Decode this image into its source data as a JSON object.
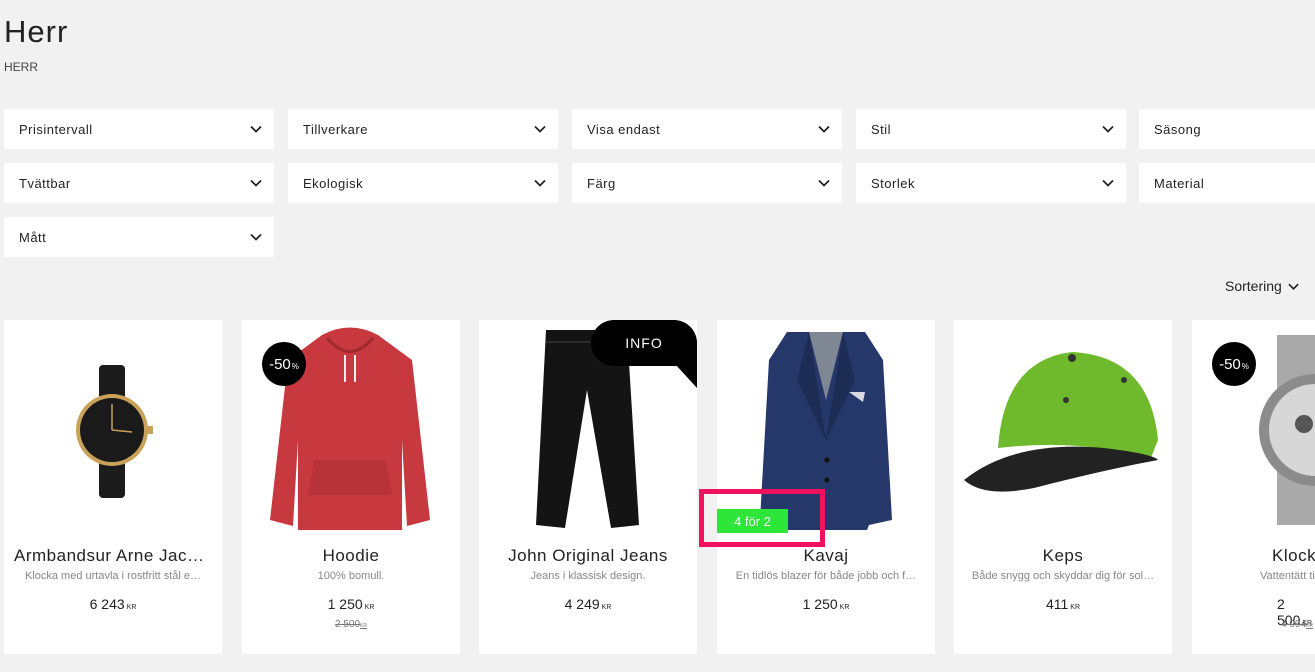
{
  "page": {
    "title": "Herr",
    "breadcrumb": "HERR"
  },
  "filters": [
    {
      "label": "Prisintervall"
    },
    {
      "label": "Tillverkare"
    },
    {
      "label": "Visa endast"
    },
    {
      "label": "Stil"
    },
    {
      "label": "Säsong"
    },
    {
      "label": "Tvättbar"
    },
    {
      "label": "Ekologisk"
    },
    {
      "label": "Färg"
    },
    {
      "label": "Storlek"
    },
    {
      "label": "Material"
    },
    {
      "label": "Mått"
    }
  ],
  "sort": {
    "label": "Sortering"
  },
  "currency": "KR",
  "products": [
    {
      "name": "Armbandsur Arne Jacobsen",
      "description": "Klocka med urtavla i rostfritt stål e…",
      "price": "6 243",
      "old_price": "",
      "badge": ""
    },
    {
      "name": "Hoodie",
      "description": "100% bomull.",
      "price": "1 250",
      "old_price": "2 500",
      "badge": "-50"
    },
    {
      "name": "John Original Jeans",
      "description": "Jeans i klassisk design.",
      "price": "4 249",
      "old_price": "",
      "badge": "INFO"
    },
    {
      "name": "Kavaj",
      "description": "En tidlös blazer för både jobb och f…",
      "price": "1 250",
      "old_price": "",
      "badge": "4 för 2"
    },
    {
      "name": "Keps",
      "description": "Både snygg och skyddar dig för sol…",
      "price": "411",
      "old_price": "",
      "badge": ""
    },
    {
      "name": "Klocka",
      "description": "Vattentätt till",
      "price": "2 500",
      "old_price": "4 994",
      "badge": "-50"
    }
  ],
  "discount_suffix": "%",
  "colors": {
    "background": "#f1f1f1",
    "promo_green": "#2ee63a",
    "highlight_pink": "#f1125f",
    "badge_black": "#000000"
  }
}
